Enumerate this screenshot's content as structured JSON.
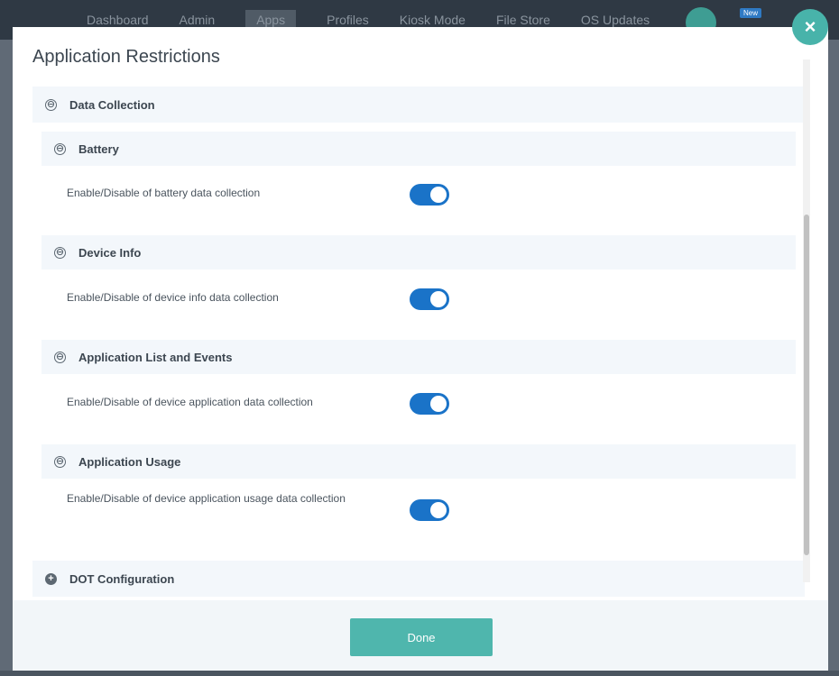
{
  "background_nav": {
    "items": [
      "Dashboard",
      "Admin",
      "Apps",
      "Profiles",
      "Kiosk Mode",
      "File Store",
      "OS Updates"
    ],
    "badge": "New"
  },
  "modal": {
    "title": "Application Restrictions",
    "close_label": "×",
    "sections": {
      "data_collection": {
        "label": "Data Collection",
        "expanded_icon": "⊖",
        "battery": {
          "label": "Battery",
          "icon": "⊖",
          "setting_label": "Enable/Disable of battery data collection",
          "enabled": true
        },
        "device_info": {
          "label": "Device Info",
          "icon": "⊖",
          "setting_label": "Enable/Disable of device info data collection",
          "enabled": true
        },
        "app_list_events": {
          "label": "Application List and Events",
          "icon": "⊖",
          "setting_label": "Enable/Disable of device application data collection",
          "enabled": true
        },
        "app_usage": {
          "label": "Application Usage",
          "icon": "⊖",
          "setting_label": "Enable/Disable of device application usage data collection",
          "enabled": true
        }
      },
      "dot_configuration": {
        "label": "DOT Configuration",
        "collapsed_icon": "+"
      }
    },
    "done_label": "Done"
  },
  "colors": {
    "accent": "#4fb6ad",
    "switch_on": "#1a73c8",
    "header_bg": "#f3f7fb"
  }
}
